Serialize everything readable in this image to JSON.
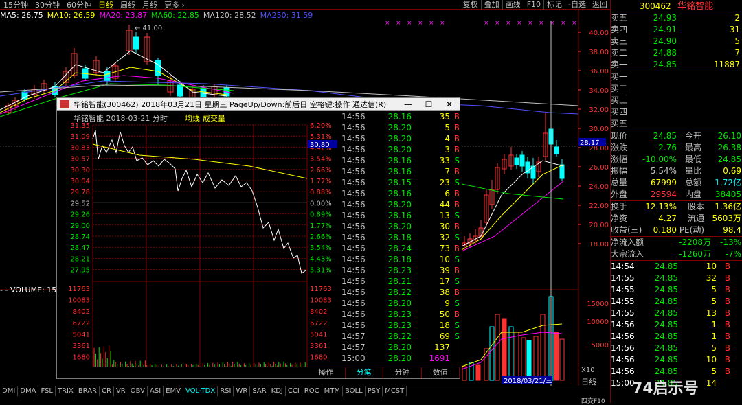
{
  "period_tabs": [
    "15分钟",
    "30分钟",
    "60分钟",
    "日线",
    "周线",
    "月线",
    "更多 ›"
  ],
  "active_period": "日线",
  "tools": [
    "复权",
    "叠加",
    "画线",
    "F10",
    "标记",
    "-自选",
    "返回"
  ],
  "ma_legend": [
    {
      "label": "MA5: 26.75",
      "color": "#ffffff"
    },
    {
      "label": "MA10: 26.59",
      "color": "#ffff00"
    },
    {
      "label": "MA20: 23.87",
      "color": "#ff00ff"
    },
    {
      "label": "MA60: 22.85",
      "color": "#00e600"
    },
    {
      "label": "MA120: 28.52",
      "color": "#c0c0c0"
    },
    {
      "label": "MA250: 31.59",
      "color": "#5050ff"
    }
  ],
  "price_axis": [
    "40.00",
    "38.00",
    "36.00",
    "34.00",
    "32.00",
    "30.00",
    "28.00",
    "26.00",
    "24.00",
    "22.00",
    "20.00",
    "18.00"
  ],
  "price_tag": "28.17",
  "high_mark": "41.00",
  "vol_axis": [
    "15000",
    "10000",
    "5000"
  ],
  "vol_legend": "VOLUME: 15",
  "vol_unit": "X10",
  "date_tag": "2018/03/21/三",
  "popup": {
    "title": "华铭智能(300462) 2018年03月21日 星期三 PageUp/Down:前后日 空格键:操作 通达信(R)",
    "chart_header": {
      "name": "华铭智能",
      "date": "2018-03-21 分时",
      "avg": "均线",
      "vol": "成交量"
    },
    "left_axis": [
      "31.35",
      "31.09",
      "30.83",
      "30.57",
      "30.30",
      "30.04",
      "29.78",
      "29.52",
      "29.26",
      "29.00",
      "28.74",
      "28.47",
      "28.21",
      "27.95"
    ],
    "right_axis": [
      "6.20%",
      "5.31%",
      "4.42%",
      "3.54%",
      "2.66%",
      "1.77%",
      "0.88%",
      "0.00%",
      "0.89%",
      "1.77%",
      "2.66%",
      "3.54%",
      "4.43%",
      "5.31%"
    ],
    "left_vol_axis": [
      "11763",
      "10083",
      "8402",
      "6722",
      "5041",
      "3361",
      "1680"
    ],
    "right_vol_axis": [
      "11763",
      "10083",
      "8402",
      "6722",
      "5041",
      "3361",
      "1680"
    ],
    "cursor_price": "30.80",
    "time_labels": [
      "09:30",
      "10:30",
      "13:00",
      "14:00"
    ],
    "ticks": [
      {
        "t": "14:56",
        "p": "28.16",
        "v": "35",
        "f": "B",
        "pc": "#00e600",
        "fc": "#ff3232"
      },
      {
        "t": "14:56",
        "p": "28.20",
        "v": "5",
        "f": "B",
        "pc": "#00e600",
        "fc": "#ff3232"
      },
      {
        "t": "14:56",
        "p": "28.20",
        "v": "4",
        "f": "B",
        "pc": "#00e600",
        "fc": "#ff3232"
      },
      {
        "t": "14:56",
        "p": "28.20",
        "v": "3",
        "f": "B",
        "pc": "#00e600",
        "fc": "#ff3232"
      },
      {
        "t": "14:56",
        "p": "28.16",
        "v": "33",
        "f": "S",
        "pc": "#00e600",
        "fc": "#00e600"
      },
      {
        "t": "14:56",
        "p": "28.16",
        "v": "7",
        "f": "B",
        "pc": "#00e600",
        "fc": "#ff3232"
      },
      {
        "t": "14:56",
        "p": "28.15",
        "v": "23",
        "f": "S",
        "pc": "#00e600",
        "fc": "#00e600"
      },
      {
        "t": "14:56",
        "p": "28.16",
        "v": "6",
        "f": "B",
        "pc": "#00e600",
        "fc": "#ff3232"
      },
      {
        "t": "14:56",
        "p": "28.20",
        "v": "44",
        "f": "B",
        "pc": "#00e600",
        "fc": "#ff3232"
      },
      {
        "t": "14:56",
        "p": "28.16",
        "v": "13",
        "f": "S",
        "pc": "#00e600",
        "fc": "#00e600"
      },
      {
        "t": "14:56",
        "p": "28.20",
        "v": "30",
        "f": "B",
        "pc": "#00e600",
        "fc": "#ff3232"
      },
      {
        "t": "14:56",
        "p": "28.18",
        "v": "32",
        "f": "S",
        "pc": "#00e600",
        "fc": "#00e600"
      },
      {
        "t": "14:56",
        "p": "28.24",
        "v": "73",
        "f": "B",
        "pc": "#00e600",
        "fc": "#ff3232"
      },
      {
        "t": "14:56",
        "p": "28.18",
        "v": "10",
        "f": "S",
        "pc": "#00e600",
        "fc": "#00e600"
      },
      {
        "t": "14:56",
        "p": "28.23",
        "v": "39",
        "f": "B",
        "pc": "#00e600",
        "fc": "#ff3232"
      },
      {
        "t": "14:56",
        "p": "28.21",
        "v": "17",
        "f": "S",
        "pc": "#00e600",
        "fc": "#00e600"
      },
      {
        "t": "14:56",
        "p": "28.22",
        "v": "38",
        "f": "B",
        "pc": "#00e600",
        "fc": "#ff3232"
      },
      {
        "t": "14:56",
        "p": "28.20",
        "v": "9",
        "f": "S",
        "pc": "#00e600",
        "fc": "#00e600"
      },
      {
        "t": "14:56",
        "p": "28.23",
        "v": "50",
        "f": "B",
        "pc": "#00e600",
        "fc": "#ff3232"
      },
      {
        "t": "14:56",
        "p": "28.23",
        "v": "18",
        "f": "S",
        "pc": "#00e600",
        "fc": "#00e600"
      },
      {
        "t": "14:57",
        "p": "28.22",
        "v": "69",
        "f": "S",
        "pc": "#00e600",
        "fc": "#00e600"
      },
      {
        "t": "14:57",
        "p": "28.20",
        "v": "137",
        "f": "",
        "pc": "#00e600",
        "fc": "#ff3232"
      },
      {
        "t": "15:00",
        "p": "28.20",
        "v": "1691",
        "f": "",
        "pc": "#00e600",
        "fc": "#ff00ff"
      }
    ],
    "tabs": [
      "操作",
      "分笔",
      "分钟",
      "数值"
    ],
    "active_tab": "分笔"
  },
  "quote": {
    "code": "300462",
    "name": "华铭智能",
    "asks": [
      {
        "label": "卖五",
        "price": "24.93",
        "vol": "2"
      },
      {
        "label": "卖四",
        "price": "24.91",
        "vol": "31"
      },
      {
        "label": "卖三",
        "price": "24.90",
        "vol": "5"
      },
      {
        "label": "卖二",
        "price": "24.88",
        "vol": "7"
      },
      {
        "label": "卖一",
        "price": "24.85",
        "vol": "11887"
      }
    ],
    "bids": [
      "买一",
      "买二",
      "买三",
      "买四",
      "买五"
    ],
    "stats": [
      {
        "l1": "现价",
        "v1": "24.85",
        "c1": "#00e600",
        "l2": "今开",
        "v2": "26.10",
        "c2": "#00e600"
      },
      {
        "l1": "涨跌",
        "v1": "-2.76",
        "c1": "#00e600",
        "l2": "最高",
        "v2": "26.38",
        "c2": "#00e600"
      },
      {
        "l1": "涨幅",
        "v1": "-10.00%",
        "c1": "#00e600",
        "l2": "最低",
        "v2": "24.85",
        "c2": "#00e600"
      },
      {
        "l1": "振幅",
        "v1": "5.54%",
        "c1": "#c0c0c0",
        "l2": "量比",
        "v2": "0.69",
        "c2": "#ffff00"
      },
      {
        "l1": "总量",
        "v1": "67999",
        "c1": "#ffff00",
        "l2": "总额",
        "v2": "1.72亿",
        "c2": "#00ffff"
      },
      {
        "l1": "外盘",
        "v1": "29594",
        "c1": "#ff3232",
        "l2": "内盘",
        "v2": "38405",
        "c2": "#00e600"
      }
    ],
    "stats2": [
      {
        "l1": "换手",
        "v1": "12.13%",
        "c1": "#ffff00",
        "l2": "股本",
        "v2": "1.36亿",
        "c2": "#ffff00"
      },
      {
        "l1": "净资",
        "v1": "4.27",
        "c1": "#ffff00",
        "l2": "流通",
        "v2": "5603万",
        "c2": "#ffff00"
      },
      {
        "l1": "收益(三)",
        "v1": "0.180",
        "c1": "#ffff00",
        "l2": "PE(动)",
        "v2": "98.4",
        "c2": "#ffff00"
      }
    ],
    "flows": [
      {
        "l": "净流入额",
        "v": "-2208万",
        "p": "-13%"
      },
      {
        "l": "大宗流入",
        "v": "-1260万",
        "p": "-7%"
      }
    ],
    "trades": [
      {
        "t": "14:54",
        "p": "24.85",
        "v": "10",
        "f": "B"
      },
      {
        "t": "14:55",
        "p": "24.85",
        "v": "32",
        "f": "B"
      },
      {
        "t": "14:55",
        "p": "24.85",
        "v": "5",
        "f": "B"
      },
      {
        "t": "14:55",
        "p": "24.85",
        "v": "5",
        "f": "B"
      },
      {
        "t": "14:55",
        "p": "24.85",
        "v": "13",
        "f": "B"
      },
      {
        "t": "14:56",
        "p": "24.85",
        "v": "1",
        "f": "B"
      },
      {
        "t": "14:56",
        "p": "24.85",
        "v": "1",
        "f": "B"
      },
      {
        "t": "14:56",
        "p": "24.85",
        "v": "5",
        "f": "B"
      },
      {
        "t": "14:56",
        "p": "24.85",
        "v": "10",
        "f": "B"
      },
      {
        "t": "14:56",
        "p": "24.85",
        "v": "5",
        "f": "B"
      },
      {
        "t": "15:00",
        "p": "24.85",
        "v": "14",
        "f": ""
      }
    ]
  },
  "bottom_tabs": [
    "DMI",
    "DMA",
    "FSL",
    "TRIX",
    "BRAR",
    "CR",
    "VR",
    "OBV",
    "ASI",
    "EMV",
    "VOL-TDX",
    "RSI",
    "WR",
    "SAR",
    "KDJ",
    "CCI",
    "ROC",
    "MTM",
    "BOLL",
    "PSY",
    "MCST"
  ],
  "active_bottom_tab": "VOL-TDX",
  "right_bottom_tabs": [
    "日线",
    "笔",
    "价",
    "细",
    "势",
    "联",
    "值",
    "主",
    "筹"
  ],
  "watermark": "74启示号",
  "status_text": "四交F10"
}
